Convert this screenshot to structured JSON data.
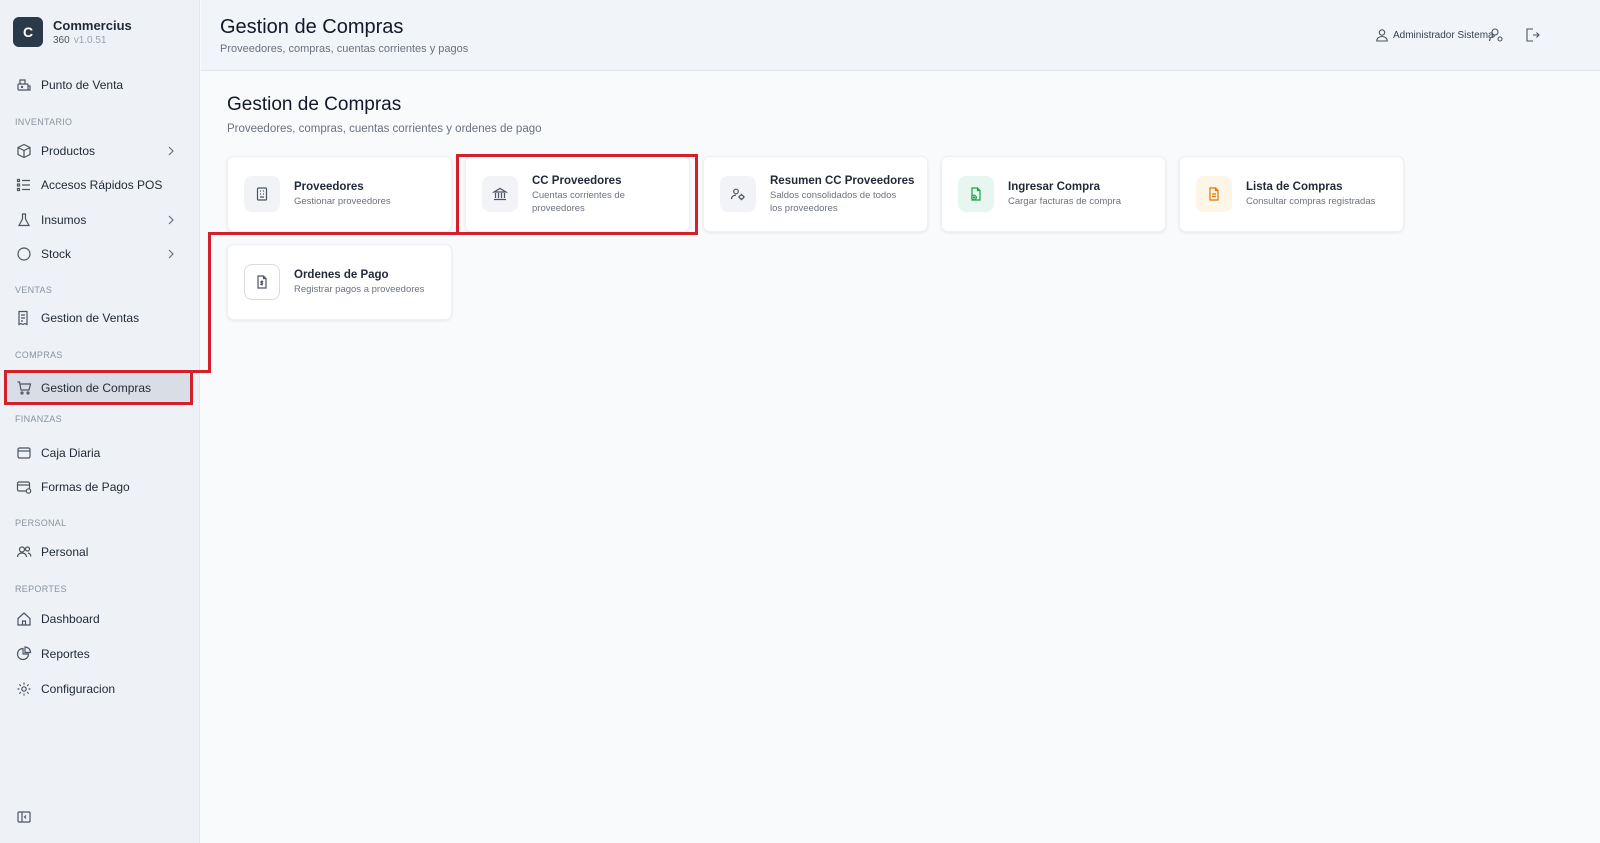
{
  "brand": {
    "logo_letter": "C",
    "name": "Commercius",
    "edition": "360",
    "version": "v1.0.51"
  },
  "sidebar": {
    "items": [
      {
        "label": "Punto de Venta",
        "icon": "cash-register-icon"
      },
      {
        "label": "Productos",
        "icon": "box-icon",
        "has_submenu": true
      },
      {
        "label": "Accesos Rápidos POS",
        "icon": "list-icon"
      },
      {
        "label": "Insumos",
        "icon": "flask-icon",
        "has_submenu": true
      },
      {
        "label": "Stock",
        "icon": "circle-icon",
        "has_submenu": true
      },
      {
        "label": "Gestion de Ventas",
        "icon": "receipt-icon"
      },
      {
        "label": "Gestion de Compras",
        "icon": "cart-icon",
        "active": true
      },
      {
        "label": "Caja Diaria",
        "icon": "wallet-icon"
      },
      {
        "label": "Formas de Pago",
        "icon": "card-icon"
      },
      {
        "label": "Personal",
        "icon": "users-icon"
      },
      {
        "label": "Dashboard",
        "icon": "home-icon"
      },
      {
        "label": "Reportes",
        "icon": "chart-icon"
      },
      {
        "label": "Configuracion",
        "icon": "gear-icon"
      }
    ],
    "sections": [
      "INVENTARIO",
      "VENTAS",
      "COMPRAS",
      "FINANZAS",
      "PERSONAL",
      "REPORTES"
    ]
  },
  "header": {
    "title": "Gestion de Compras",
    "subtitle": "Proveedores, compras, cuentas corrientes y pagos",
    "user_name": "Administrador Sistema"
  },
  "main": {
    "title": "Gestion de Compras",
    "subtitle": "Proveedores, compras, cuentas corrientes y ordenes de pago",
    "cards": [
      {
        "title": "Proveedores",
        "desc": "Gestionar proveedores",
        "icon": "building-icon"
      },
      {
        "title": "CC Proveedores",
        "desc": "Cuentas corrientes de proveedores",
        "icon": "bank-icon"
      },
      {
        "title": "Resumen CC Proveedores",
        "desc": "Saldos consolidados de todos los proveedores",
        "icon": "users-settings-icon"
      },
      {
        "title": "Ingresar Compra",
        "desc": "Cargar facturas de compra",
        "icon": "file-plus-icon"
      },
      {
        "title": "Lista de Compras",
        "desc": "Consultar compras registradas",
        "icon": "file-text-icon"
      },
      {
        "title": "Ordenes de Pago",
        "desc": "Registrar pagos a proveedores",
        "icon": "file-dollar-icon"
      }
    ]
  },
  "colors": {
    "highlight": "#d4202a",
    "brand_bg": "#2b3a4a",
    "accent_green": "#16a34a",
    "accent_amber": "#d97706"
  }
}
